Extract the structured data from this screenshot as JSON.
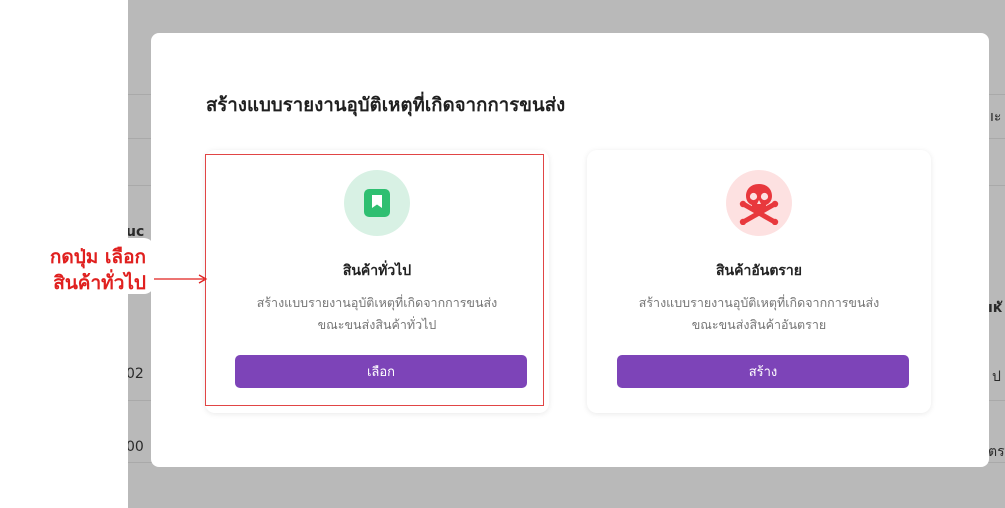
{
  "background": {
    "fragments": [
      "uc",
      "02",
      "00",
      "ıะ",
      "ıкั",
      "ป",
      "ตร"
    ]
  },
  "modal": {
    "title": "สร้างแบบรายงานอุบัติเหตุที่เกิดจากการขนส่ง"
  },
  "cards": [
    {
      "icon": "bookmark-icon",
      "title": "สินค้าทั่วไป",
      "desc_line1": "สร้างแบบรายงานอุบัติเหตุที่เกิดจากการขนส่ง",
      "desc_line2": "ขณะขนส่งสินค้าทั่วไป",
      "button_label": "เลือก",
      "accent": "#2fbf71"
    },
    {
      "icon": "skull-crossbones-icon",
      "title": "สินค้าอันตราย",
      "desc_line1": "สร้างแบบรายงานอุบัติเหตุที่เกิดจากการขนส่ง",
      "desc_line2": "ขณะขนส่งสินค้าอันตราย",
      "button_label": "สร้าง",
      "accent": "#e8383d"
    }
  ],
  "annotation": {
    "line1": "กดปุ่ม เลือก",
    "line2": "สินค้าทั่วไป",
    "color": "#e0201f"
  },
  "colors": {
    "button": "#7d44b8",
    "overlay": "#b9b9b9"
  }
}
